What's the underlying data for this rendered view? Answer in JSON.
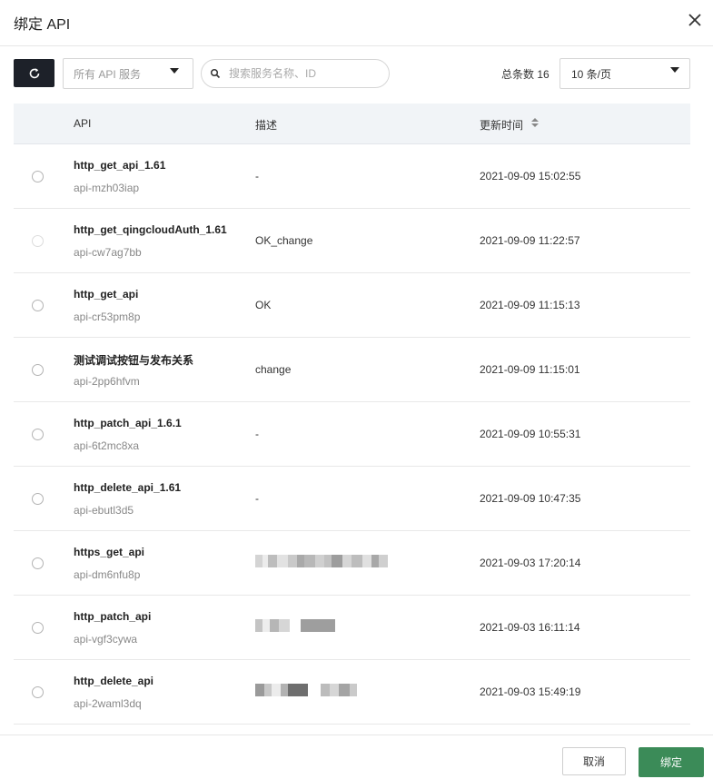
{
  "dialog": {
    "title": "绑定 API"
  },
  "toolbar": {
    "service_select": "所有 API 服务",
    "search_placeholder": "搜索服务名称、ID",
    "total_label": "总条数 16",
    "page_size": "10 条/页"
  },
  "table": {
    "headers": {
      "api": "API",
      "desc": "描述",
      "updated": "更新时间"
    },
    "rows": [
      {
        "name": "http_get_api_1.61",
        "id": "api-mzh03iap",
        "desc": "-",
        "time": "2021-09-09 15:02:55",
        "disabled": false,
        "blurred": false
      },
      {
        "name": "http_get_qingcloudAuth_1.61",
        "id": "api-cw7ag7bb",
        "desc": "OK_change",
        "time": "2021-09-09 11:22:57",
        "disabled": true,
        "blurred": false
      },
      {
        "name": "http_get_api",
        "id": "api-cr53pm8p",
        "desc": "OK",
        "time": "2021-09-09 11:15:13",
        "disabled": false,
        "blurred": false
      },
      {
        "name": "测试调试按钮与发布关系",
        "id": "api-2pp6hfvm",
        "desc": "change",
        "time": "2021-09-09 11:15:01",
        "disabled": false,
        "blurred": false
      },
      {
        "name": "http_patch_api_1.6.1",
        "id": "api-6t2mc8xa",
        "desc": "-",
        "time": "2021-09-09 10:55:31",
        "disabled": false,
        "blurred": false
      },
      {
        "name": "http_delete_api_1.61",
        "id": "api-ebutl3d5",
        "desc": "-",
        "time": "2021-09-09 10:47:35",
        "disabled": false,
        "blurred": false
      },
      {
        "name": "https_get_api",
        "id": "api-dm6nfu8p",
        "desc": "",
        "time": "2021-09-03 17:20:14",
        "disabled": false,
        "blurred": true
      },
      {
        "name": "http_patch_api",
        "id": "api-vgf3cywa",
        "desc": "",
        "time": "2021-09-03 16:11:14",
        "disabled": false,
        "blurred": true
      },
      {
        "name": "http_delete_api",
        "id": "api-2waml3dq",
        "desc": "",
        "time": "2021-09-03 15:49:19",
        "disabled": false,
        "blurred": true
      }
    ]
  },
  "footer": {
    "cancel_label": "取消",
    "bind_label": "绑定"
  },
  "colors": {
    "primary": "#3b8b58",
    "dark": "#1d2129",
    "header_bg": "#f1f4f7"
  }
}
